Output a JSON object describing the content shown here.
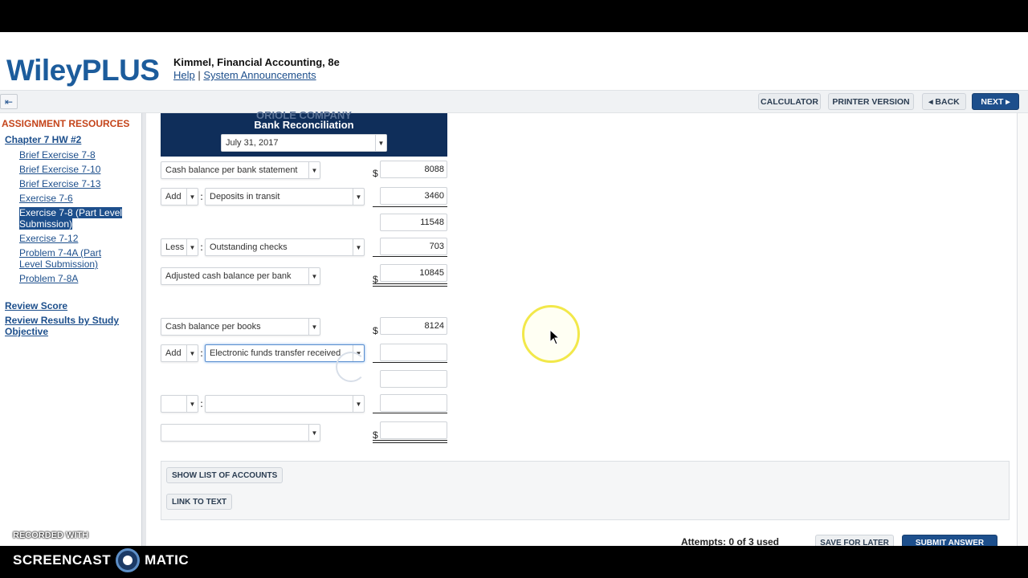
{
  "header": {
    "logo": "WileyPLUS",
    "book_title": "Kimmel, Financial Accounting, 8e",
    "help_link": "Help",
    "separator": "|",
    "announcements_link": "System Announcements"
  },
  "toolbar": {
    "calculator": "CALCULATOR",
    "printer": "PRINTER VERSION",
    "back": "◂ BACK",
    "next": "NEXT ▸"
  },
  "sidebar": {
    "title": "ASSIGNMENT RESOURCES",
    "chapter": "Chapter 7 HW #2",
    "items": [
      {
        "label": "Brief Exercise 7-8"
      },
      {
        "label": "Brief Exercise 7-10"
      },
      {
        "label": "Brief Exercise 7-13"
      },
      {
        "label": "Exercise 7-6"
      },
      {
        "label": "Exercise 7-8 (Part Level"
      },
      {
        "label": "Submission)"
      },
      {
        "label": "Exercise 7-12"
      },
      {
        "label": "Problem 7-4A (Part"
      },
      {
        "label": "Level Submission)"
      },
      {
        "label": "Problem 7-8A"
      }
    ],
    "review_score": "Review Score",
    "review_results_1": "Review Results by Study",
    "review_results_2": "Objective"
  },
  "reconciliation": {
    "company": "ORIOLE COMPANY",
    "title": "Bank Reconciliation",
    "date": "July 31, 2017",
    "currency": "$",
    "bank_section": {
      "cash_balance_label": "Cash balance per bank statement",
      "cash_balance_value": "8088",
      "add_op": "Add",
      "add_label": "Deposits in transit",
      "add_value": "3460",
      "subtotal": "11548",
      "less_op": "Less",
      "less_label": "Outstanding checks",
      "less_value": "703",
      "adjusted_label": "Adjusted cash balance per bank",
      "adjusted_value": "10845"
    },
    "book_section": {
      "cash_balance_label": "Cash balance per books",
      "cash_balance_value": "8124",
      "add_op": "Add",
      "add_label": "Electronic funds transfer received",
      "add_value": "",
      "subtotal": "",
      "op2": "",
      "label2": "",
      "value2": "",
      "final_label": "",
      "final_value": ""
    }
  },
  "panel": {
    "show_accounts": "SHOW LIST OF ACCOUNTS",
    "link_text": "LINK TO TEXT"
  },
  "footer": {
    "attempts": "Attempts: 0 of 3 used",
    "save_later": "SAVE FOR LATER",
    "submit": "SUBMIT ANSWER"
  },
  "recorder": {
    "recorded_with": "RECORDED WITH",
    "brand_left": "SCREENCAST",
    "brand_right": "MATIC"
  }
}
